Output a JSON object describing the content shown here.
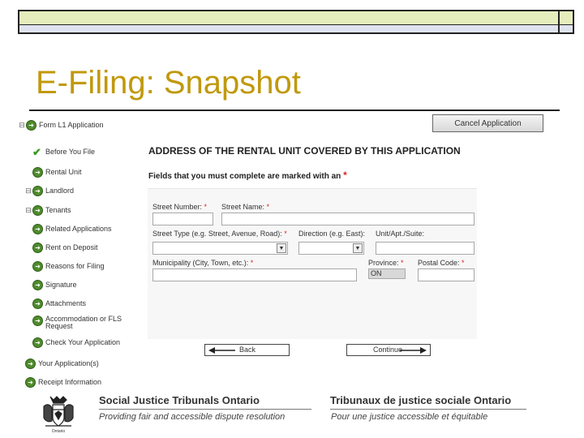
{
  "slide": {
    "title": "E-Filing: Snapshot"
  },
  "nav": {
    "items": [
      {
        "label": "Form L1 Application",
        "indicator": "green-arrow-icon",
        "expander": "⊟"
      },
      {
        "label": "Before You File",
        "indicator": "checkmark-icon",
        "expander": ""
      },
      {
        "label": "Rental Unit",
        "indicator": "green-arrow-icon",
        "expander": ""
      },
      {
        "label": "Landlord",
        "indicator": "green-arrow-icon",
        "expander": "⊟"
      },
      {
        "label": "Tenants",
        "indicator": "green-arrow-icon",
        "expander": "⊟"
      },
      {
        "label": "Related Applications",
        "indicator": "green-arrow-icon",
        "expander": ""
      },
      {
        "label": "Rent on Deposit",
        "indicator": "green-arrow-icon",
        "expander": ""
      },
      {
        "label": "Reasons for Filing",
        "indicator": "green-arrow-icon",
        "expander": ""
      },
      {
        "label": "Signature",
        "indicator": "green-arrow-icon",
        "expander": ""
      },
      {
        "label": "Attachments",
        "indicator": "green-arrow-icon",
        "expander": ""
      },
      {
        "label": "Accommodation or FLS",
        "label2": "Request",
        "indicator": "green-arrow-icon",
        "expander": ""
      },
      {
        "label": "Check Your Application",
        "indicator": "green-arrow-icon",
        "expander": ""
      },
      {
        "label": "Your Application(s)",
        "indicator": "green-arrow-icon",
        "expander": ""
      },
      {
        "label": "Receipt Information",
        "indicator": "green-arrow-icon",
        "expander": ""
      }
    ]
  },
  "actions": {
    "cancel_label": "Cancel Application",
    "back_label": "Back",
    "continue_label": "Continue"
  },
  "form": {
    "section_title": "ADDRESS OF THE RENTAL UNIT COVERED BY THIS APPLICATION",
    "required_note": "Fields that you must complete are marked with an",
    "required_marker": "*",
    "fields": {
      "street_number": {
        "label": "Street Number:",
        "required": "*",
        "value": ""
      },
      "street_name": {
        "label": "Street Name:",
        "required": "*",
        "value": ""
      },
      "street_type": {
        "label": "Street Type (e.g. Street, Avenue, Road):",
        "required": "*",
        "value": ""
      },
      "direction": {
        "label": "Direction (e.g. East):",
        "value": ""
      },
      "unit": {
        "label": "Unit/Apt./Suite:",
        "value": ""
      },
      "municipality": {
        "label": "Municipality (City, Town, etc.):",
        "required": "*",
        "value": ""
      },
      "province": {
        "label": "Province:",
        "required": "*",
        "value": "ON"
      },
      "postal_code": {
        "label": "Postal Code:",
        "required": "*",
        "value": ""
      }
    }
  },
  "footer": {
    "org_en": "Social Justice Tribunals Ontario",
    "tagline_en": "Providing fair and accessible dispute resolution",
    "org_fr": "Tribunaux de justice sociale Ontario",
    "tagline_fr": "Pour une justice accessible et équitable",
    "crest_caption": "Ontario"
  },
  "colors": {
    "title": "#c0990c",
    "nav_bullet": "#4e8b2c",
    "required": "#d22222"
  }
}
